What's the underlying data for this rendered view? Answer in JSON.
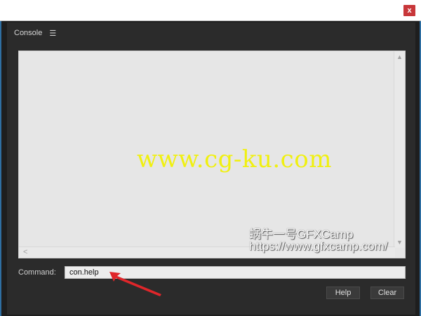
{
  "window": {
    "close_glyph": "x"
  },
  "panel": {
    "title": "Console",
    "menu_glyph": "☰"
  },
  "output": {
    "scroll_up_glyph": "▲",
    "scroll_down_glyph": "▼",
    "scroll_left_glyph": "<"
  },
  "watermark": {
    "main": "www.cg-ku.com",
    "line1": "蜗牛一号GFXCamp",
    "line2": "https://www.gfxcamp.com/"
  },
  "command": {
    "label": "Command:",
    "value": "con.help"
  },
  "buttons": {
    "help": "Help",
    "clear": "Clear"
  },
  "colors": {
    "panel_bg": "#2b2b2b",
    "accent_border": "#2f6fa2",
    "close_red": "#c8373a",
    "annotation_red": "#e0262a",
    "watermark_yellow": "#f0f010"
  }
}
